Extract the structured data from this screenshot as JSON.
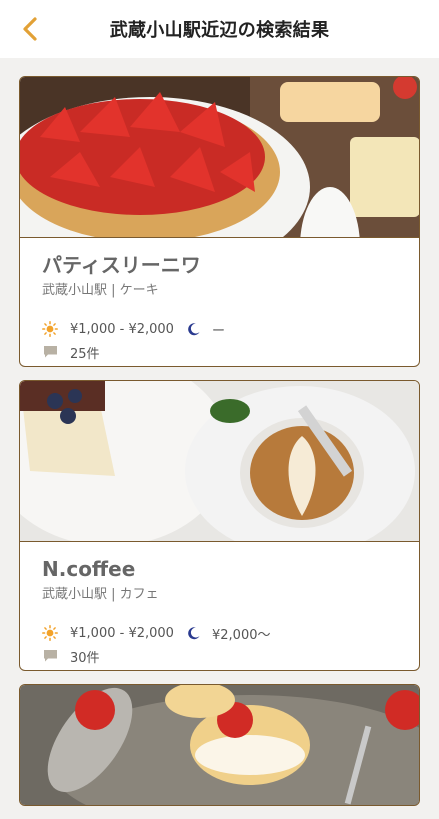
{
  "header": {
    "title": "武蔵小山駅近辺の検索結果",
    "back_icon": "chevron-left-icon",
    "accent_color": "#e2a136"
  },
  "results": [
    {
      "name": "パティスリーニワ",
      "meta": "武蔵小山駅 | ケーキ",
      "lunch_price": "¥1,000 - ¥2,000",
      "dinner_price": "ー",
      "reviews": "25件"
    },
    {
      "name": "N.coffee",
      "meta": "武蔵小山駅 | カフェ",
      "lunch_price": "¥1,000 - ¥2,000",
      "dinner_price": "¥2,000〜",
      "reviews": "30件"
    }
  ],
  "icons": {
    "lunch": "sun-icon",
    "dinner": "moon-icon",
    "reviews": "comment-icon"
  },
  "colors": {
    "sun": "#f2a22a",
    "moon": "#2a3a8f",
    "comment": "#b8b1a4",
    "card_border": "#7a5a2e"
  }
}
